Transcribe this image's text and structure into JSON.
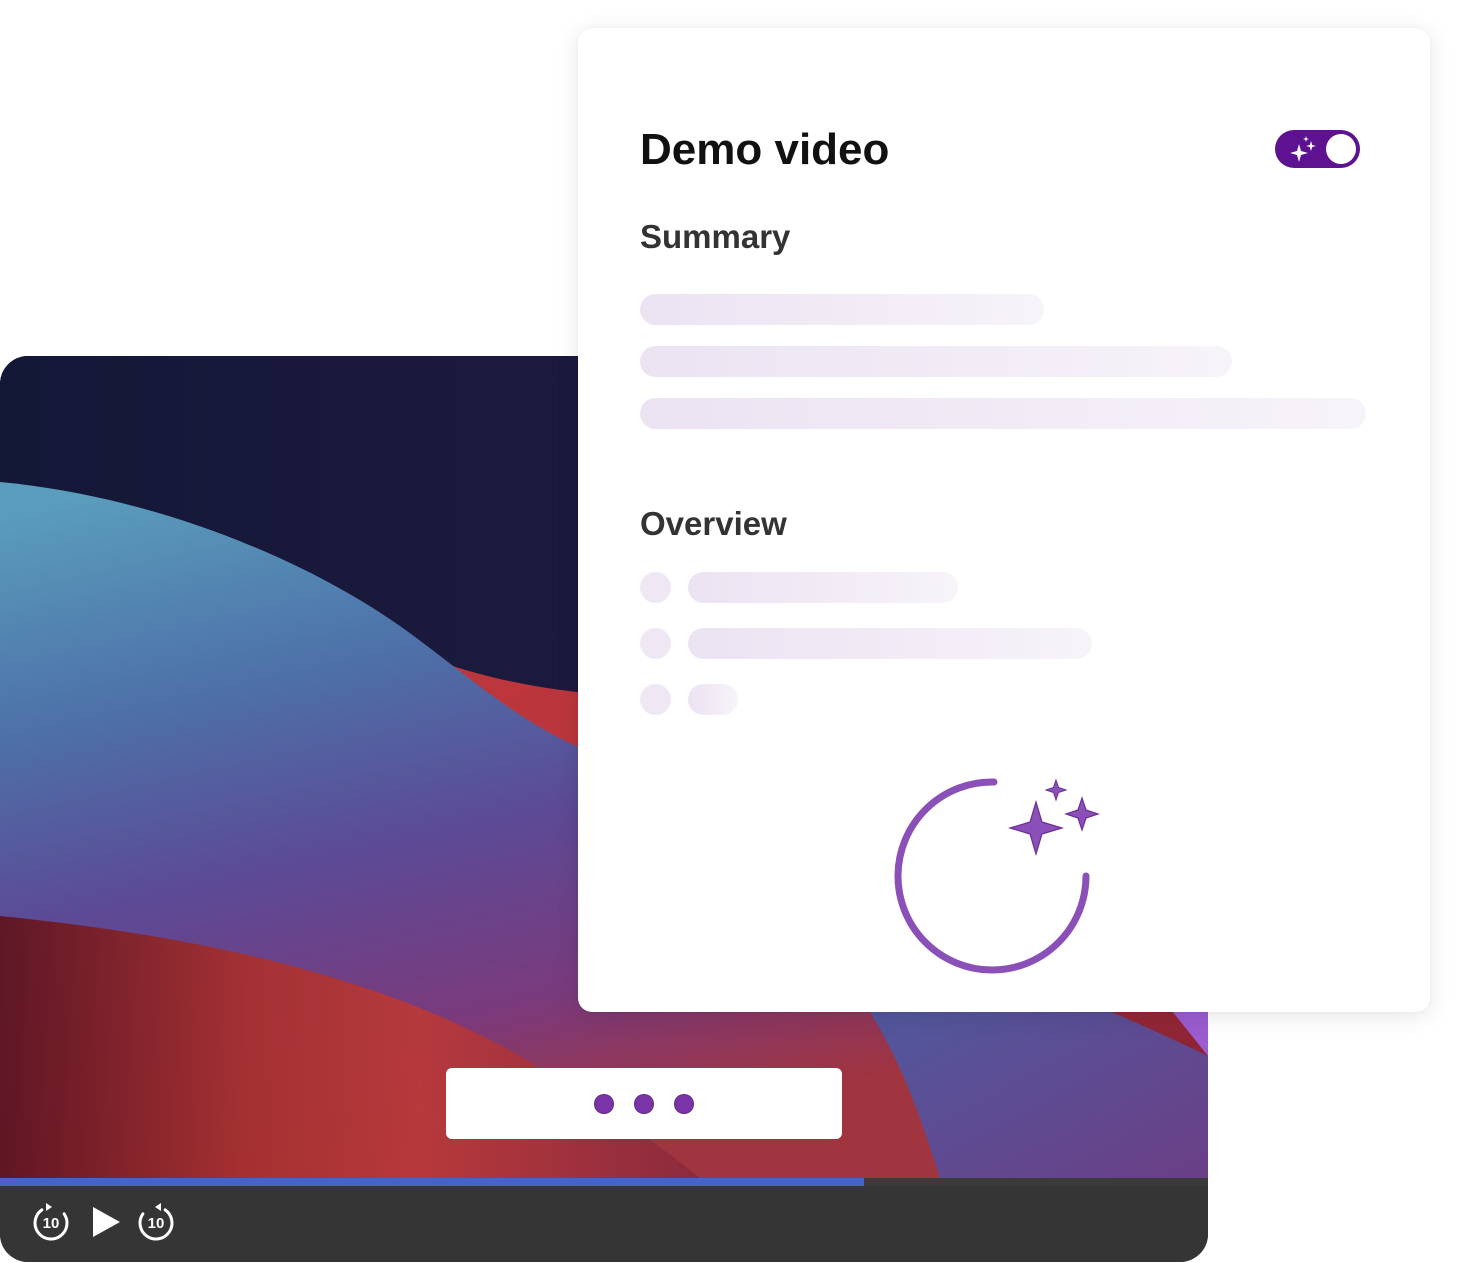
{
  "card": {
    "title": "Demo video",
    "summary_heading": "Summary",
    "overview_heading": "Overview",
    "ai_toggle": {
      "state": "on",
      "icon": "sparkles-icon",
      "color": "#5e1190"
    },
    "status": "loading",
    "spinner_icon": "ai-sparkle-spinner-icon"
  },
  "player": {
    "state": "paused",
    "progress_fraction": 0.715,
    "loading_dots": 3,
    "controls": {
      "rewind_seconds": "10",
      "forward_seconds": "10",
      "play_icon": "play-icon",
      "rewind_icon": "rewind-10-icon",
      "forward_icon": "forward-10-icon"
    }
  },
  "colors": {
    "accent": "#5e1190",
    "spinner": "#8b4fb8",
    "progress": "#4a62c4",
    "controls_bg": "#353535"
  }
}
